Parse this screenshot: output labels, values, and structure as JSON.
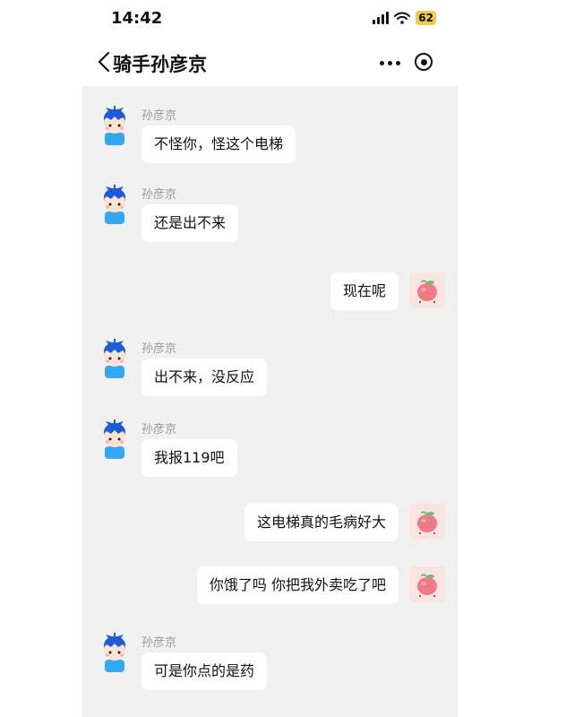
{
  "status_bar": {
    "time": "14:42",
    "battery": "62"
  },
  "header": {
    "title": "骑手孙彦京"
  },
  "icons": {
    "back": "chevron-left-icon",
    "more": "more-dots-icon",
    "target": "target-icon",
    "rider_avatar": "rider-avatar-icon",
    "user_avatar": "peach-avatar-icon"
  },
  "colors": {
    "chat_bg": "#f1f1f1",
    "bubble": "#ffffff",
    "battery": "#f2c94c",
    "name": "#999999"
  },
  "messages": [
    {
      "side": "left",
      "sender": "孙彦京",
      "text": "不怪你，怪这个电梯"
    },
    {
      "side": "left",
      "sender": "孙彦京",
      "text": "还是出不来"
    },
    {
      "side": "right",
      "text": "现在呢"
    },
    {
      "side": "left",
      "sender": "孙彦京",
      "text": "出不来，没反应"
    },
    {
      "side": "left",
      "sender": "孙彦京",
      "text": "我报119吧"
    },
    {
      "side": "right",
      "text": "这电梯真的毛病好大"
    },
    {
      "side": "right",
      "text": "你饿了吗 你把我外卖吃了吧"
    },
    {
      "side": "left",
      "sender": "孙彦京",
      "text": "可是你点的是药"
    }
  ]
}
